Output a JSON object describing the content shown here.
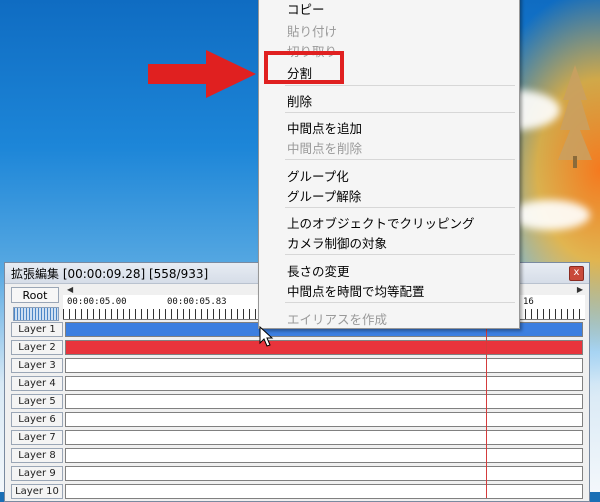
{
  "window": {
    "title": "拡張編集 [00:00:09.28] [558/933]",
    "close_label": "x",
    "root_label": "Root",
    "timecodes": [
      "00:00:05.00",
      "00:00:05.83",
      "16"
    ]
  },
  "layers": [
    "Layer 1",
    "Layer 2",
    "Layer 3",
    "Layer 4",
    "Layer 5",
    "Layer 6",
    "Layer 7",
    "Layer 8",
    "Layer 9",
    "Layer 10"
  ],
  "clip_colors": {
    "layer1": "#3d7fe0",
    "layer2": "#e8343c"
  },
  "context_menu": {
    "items": [
      {
        "label": "コピー",
        "disabled": false
      },
      {
        "label": "貼り付け",
        "disabled": true
      },
      {
        "label": "切り取り",
        "disabled": true
      },
      {
        "label": "分割",
        "disabled": false,
        "highlighted": true
      },
      {
        "label": "削除",
        "disabled": false
      },
      {
        "label": "中間点を追加",
        "disabled": false
      },
      {
        "label": "中間点を削除",
        "disabled": true
      },
      {
        "label": "グループ化",
        "disabled": false
      },
      {
        "label": "グループ解除",
        "disabled": false
      },
      {
        "label": "上のオブジェクトでクリッピング",
        "disabled": false
      },
      {
        "label": "カメラ制御の対象",
        "disabled": false
      },
      {
        "label": "長さの変更",
        "disabled": false
      },
      {
        "label": "中間点を時間で均等配置",
        "disabled": false
      },
      {
        "label": "エイリアスを作成",
        "disabled": true
      }
    ]
  },
  "annotation": {
    "highlight_color": "#e02020",
    "arrow_color": "#e02020"
  }
}
